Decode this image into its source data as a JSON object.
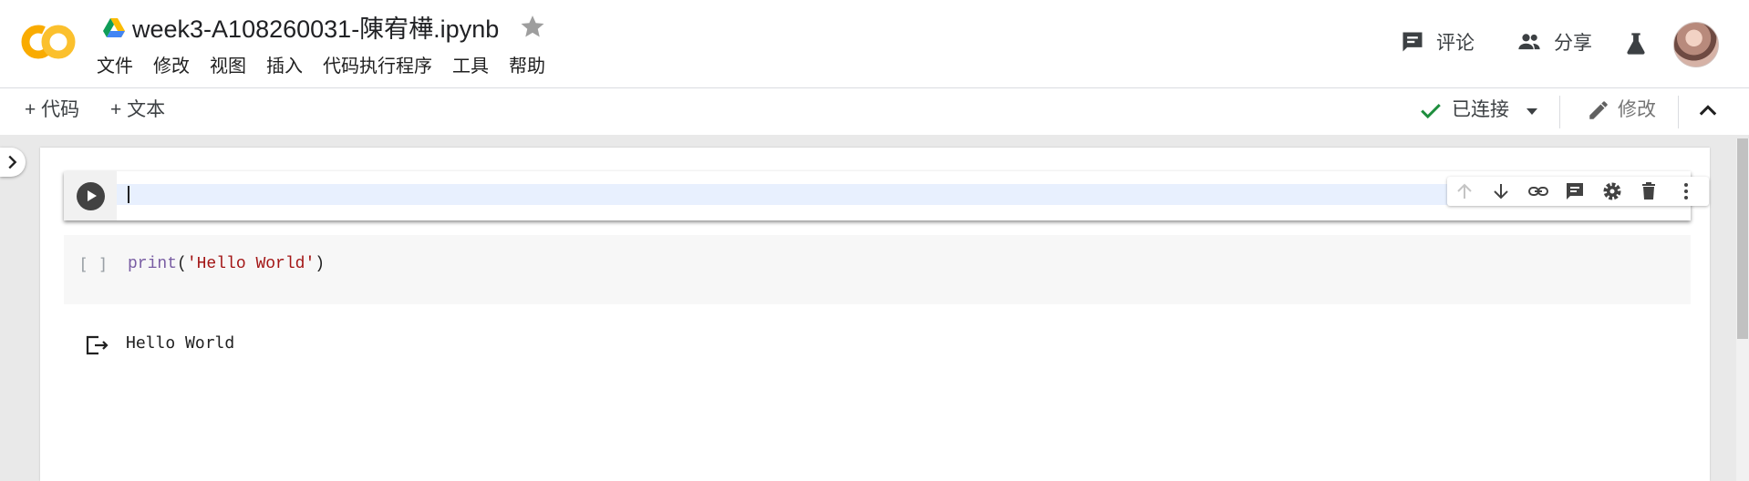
{
  "header": {
    "title": "week3-A108260031-陳宥樺.ipynb",
    "menu": [
      {
        "label": "文件"
      },
      {
        "label": "修改"
      },
      {
        "label": "视图"
      },
      {
        "label": "插入"
      },
      {
        "label": "代码执行程序"
      },
      {
        "label": "工具"
      },
      {
        "label": "帮助"
      }
    ],
    "comment_label": "评论",
    "share_label": "分享"
  },
  "toolbar": {
    "add_code_label": "+ 代码",
    "add_text_label": "+ 文本",
    "connected_label": "已连接",
    "edit_label": "修改"
  },
  "notebook": {
    "code_cell": {
      "exec_count": "[ ]",
      "code_fn": "print",
      "code_open": "(",
      "code_str": "'Hello World'",
      "code_close": ")"
    },
    "output": {
      "text": "Hello World"
    }
  },
  "colors": {
    "logo_orange": "#f9ab00",
    "logo_yellow": "#fbc02d",
    "connected_check": "#1e8e3e",
    "editor_highlight": "#e8f0fe",
    "code_function": "#795da3",
    "code_string": "#a31515"
  },
  "icons": [
    "colab-logo-icon",
    "drive-icon",
    "star-icon",
    "comment-icon",
    "people-icon",
    "flask-icon",
    "avatar",
    "check-icon",
    "dropdown-arrow-icon",
    "pencil-icon",
    "chevron-up-icon",
    "chevron-right-icon",
    "play-icon",
    "arrow-up-icon",
    "arrow-down-icon",
    "link-icon",
    "comment-icon",
    "gear-icon",
    "trash-icon",
    "more-vert-icon",
    "output-icon"
  ]
}
